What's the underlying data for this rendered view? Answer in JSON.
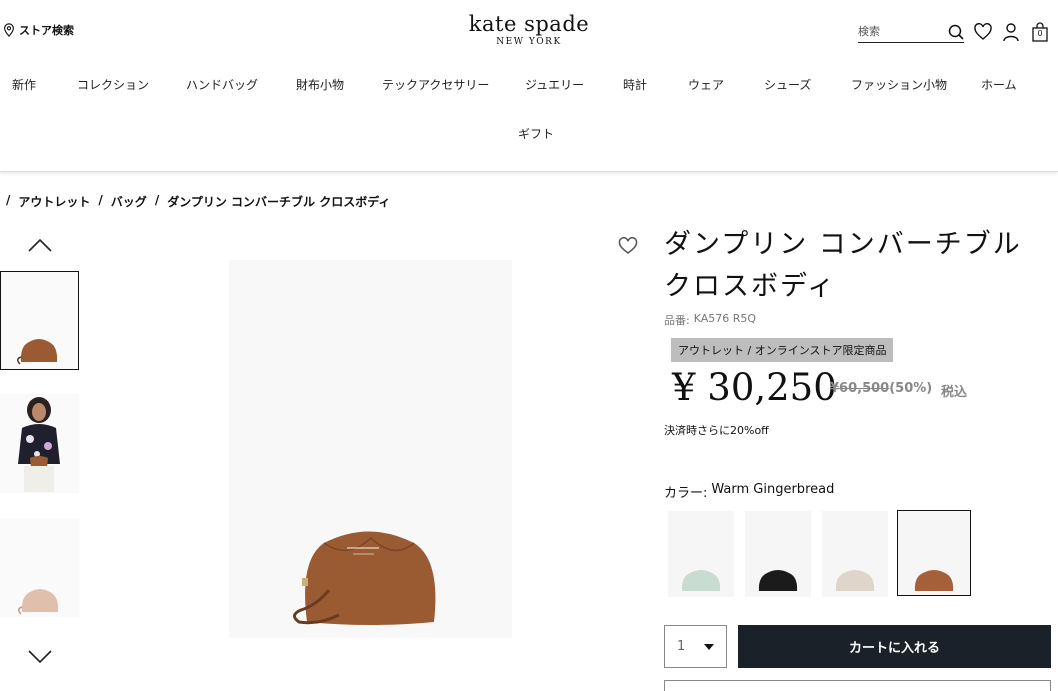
{
  "header": {
    "store_search_label": "ストア検索",
    "logo_main": "kate spade",
    "logo_sub": "NEW YORK",
    "search_placeholder": "検索",
    "cart_count": "0"
  },
  "nav": {
    "items": [
      "新作",
      "コレクション",
      "ハンドバッグ",
      "財布小物",
      "テックアクセサリー",
      "ジュエリー",
      "時計",
      "ウェア",
      "シューズ",
      "ファッション小物",
      "ホーム",
      "ギフト"
    ]
  },
  "breadcrumb": [
    "/",
    "アウトレット",
    "/",
    "バッグ",
    "/",
    "ダンプリン コンバーチブル クロスボディ"
  ],
  "product": {
    "title": "ダンプリン コンバーチブル クロスボディ",
    "sku_label": "品番:",
    "sku": "KA576 R5Q",
    "badge": "アウトレット / オンラインストア限定商品",
    "price": "¥ 30,250",
    "old_price": "¥60,500",
    "discount": "(50%)",
    "tax_label": "税込",
    "extra_off": "決済時さらに20%off",
    "color_label": "カラー:",
    "color_value": "Warm Gingerbread",
    "swatches": [
      {
        "name": "mint",
        "color": "#c9dcd2"
      },
      {
        "name": "black",
        "color": "#1b1b1b"
      },
      {
        "name": "cream",
        "color": "#ddd6c9"
      },
      {
        "name": "Warm Gingerbread",
        "color": "#a5603a"
      }
    ],
    "quantity": "1",
    "add_to_cart": "カートに入れる"
  },
  "colors": {
    "bag_brown": "#9a5b33",
    "cart_button": "#1a2129",
    "badge_bg": "#bdbdbd"
  }
}
